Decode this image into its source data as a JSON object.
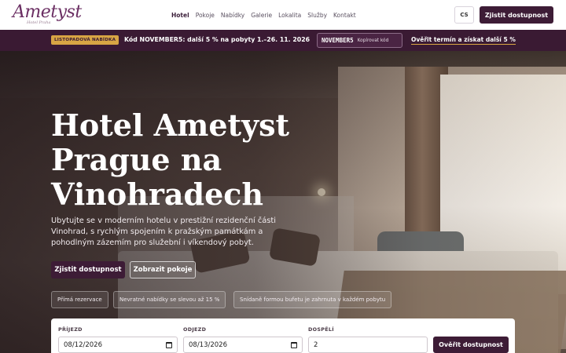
{
  "brand": {
    "logo": "Ametyst",
    "logo_sub": "Hotel Praha"
  },
  "nav": {
    "items": [
      {
        "label": "Hotel",
        "active": true
      },
      {
        "label": "Pokoje"
      },
      {
        "label": "Nabídky"
      },
      {
        "label": "Galerie"
      },
      {
        "label": "Lokalita"
      },
      {
        "label": "Služby"
      },
      {
        "label": "Kontakt"
      }
    ],
    "lang": "CS",
    "cta": "Zjistit dostupnost"
  },
  "promo": {
    "badge": "LISTOPADOVÁ NABÍDKA",
    "text": "Kód NOVEMBER5: další 5 % na pobyty 1.–26. 11. 2026",
    "code": "NOVEMBER5",
    "copy_label": "Kopírovat kód",
    "link": "Ověřit termín a získat další 5 %"
  },
  "hero": {
    "title": "Hotel Ametyst Prague na Vinohradech",
    "description": "Ubytujte se v moderním hotelu v prestižní rezidenční části Vinohrad, s rychlým spojením k pražským památkám a pohodlným zázemím pro služební i víkendový pobyt.",
    "primary_button": "Zjistit dostupnost",
    "secondary_button": "Zobrazit pokoje",
    "chips": [
      "Přímá rezervace",
      "Nevratné nabídky se slevou až 15 %",
      "Snídaně formou bufetu je zahrnuta v každém pobytu"
    ]
  },
  "booking": {
    "arrival_label": "PŘÍJEZD",
    "arrival_value": "08/12/2026",
    "departure_label": "ODJEZD",
    "departure_value": "08/13/2026",
    "adults_label": "DOSPĚLÍ",
    "adults_value": "2",
    "submit": "Ověřit dostupnost"
  },
  "colors": {
    "brand": "#3d1c36",
    "accent": "#d8a544",
    "promo_bg": "#3a1a33"
  }
}
